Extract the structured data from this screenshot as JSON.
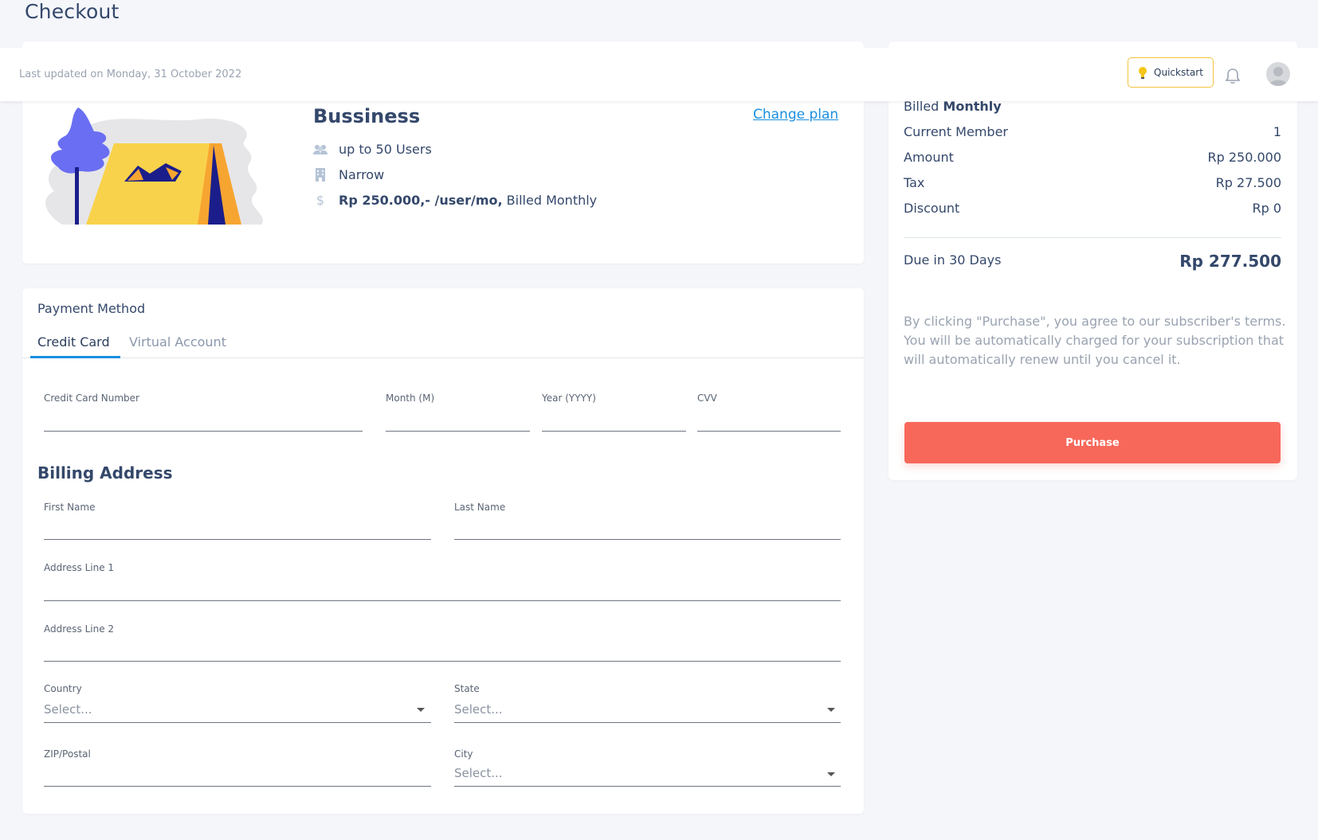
{
  "page_title": "Checkout",
  "header": {
    "last_updated": "Last updated on Monday, 31 October 2022",
    "quickstart_label": "Quickstart"
  },
  "plan": {
    "name": "Bussiness",
    "change_plan": "Change plan",
    "users": "up to 50 Users",
    "size": "Narrow",
    "price_bold": "Rp 250.000,- /user/mo,",
    "price_suffix": " Billed Monthly"
  },
  "summary": {
    "billed_prefix": "Billed ",
    "billed_bold": "Monthly",
    "rows": [
      {
        "label": "Current Member",
        "value": "1"
      },
      {
        "label": "Amount",
        "value": "Rp 250.000"
      },
      {
        "label": "Tax",
        "value": "Rp 27.500"
      },
      {
        "label": "Discount",
        "value": "Rp 0"
      }
    ],
    "due_label": "Due in 30 Days",
    "due_value": "Rp 277.500",
    "terms": "By clicking \"Purchase\", you agree to our subscriber's terms. You will be automatically charged for your subscription that will automatically renew until you cancel it.",
    "purchase_label": "Purchase"
  },
  "payment": {
    "title": "Payment Method",
    "tabs": [
      "Credit Card",
      "Virtual Account"
    ],
    "card_number_label": "Credit Card Number",
    "month_label": "Month (M)",
    "year_label": "Year (YYYY)",
    "cvv_label": "CVV"
  },
  "billing": {
    "title": "Billing Address",
    "first_name_label": "First Name",
    "last_name_label": "Last Name",
    "address1_label": "Address Line 1",
    "address2_label": "Address Line 2",
    "country_label": "Country",
    "state_label": "State",
    "zip_label": "ZIP/Postal",
    "city_label": "City",
    "select_placeholder": "Select..."
  },
  "colors": {
    "accent": "#1a8fe0",
    "purchase": "#f7685b",
    "quickstart_border": "#f3c23d"
  }
}
